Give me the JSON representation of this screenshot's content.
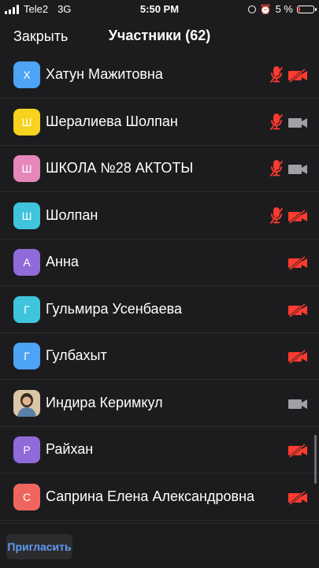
{
  "status_bar": {
    "carrier": "Tele2",
    "network": "3G",
    "time": "5:50 PM",
    "battery_percent": "5 %",
    "icons": [
      "signal-icon",
      "orientation-lock-icon",
      "alarm-icon",
      "battery-icon"
    ]
  },
  "header": {
    "close_label": "Закрыть",
    "title": "Участники (62)"
  },
  "colors": {
    "background": "#1c1c1e",
    "muted_red": "#ff3b30",
    "video_on_gray": "#a0a0a5",
    "invite_blue": "#5e9bf5"
  },
  "participants": [
    {
      "name": "Хатун Мажитовна",
      "initial": "Х",
      "avatar_color": "#4da3f5",
      "mic": "muted",
      "video": "off"
    },
    {
      "name": "Шералиева Шолпан",
      "initial": "Ш",
      "avatar_color": "#f7d21f",
      "mic": "muted",
      "video": "on"
    },
    {
      "name": "ШКОЛА №28 АКТОТЫ",
      "initial": "Ш",
      "avatar_color": "#e687ba",
      "mic": "muted",
      "video": "on"
    },
    {
      "name": "Шолпан",
      "initial": "Ш",
      "avatar_color": "#3fc4dc",
      "mic": "muted",
      "video": "off"
    },
    {
      "name": "Анна",
      "initial": "А",
      "avatar_color": "#8e6bd8",
      "mic": "none",
      "video": "off"
    },
    {
      "name": "Гульмира Усенбаева",
      "initial": "Г",
      "avatar_color": "#3fc4dc",
      "mic": "none",
      "video": "off"
    },
    {
      "name": "Гулбахыт",
      "initial": "Г",
      "avatar_color": "#4da3f5",
      "mic": "none",
      "video": "off"
    },
    {
      "name": "Индира Керимкул",
      "initial": "",
      "avatar_color": "photo",
      "mic": "none",
      "video": "on"
    },
    {
      "name": "Райхан",
      "initial": "Р",
      "avatar_color": "#8e6bd8",
      "mic": "none",
      "video": "off"
    },
    {
      "name": "Саприна Елена Александровна",
      "initial": "С",
      "avatar_color": "#f0665f",
      "mic": "none",
      "video": "off"
    }
  ],
  "footer": {
    "invite_label": "Пригласить"
  }
}
